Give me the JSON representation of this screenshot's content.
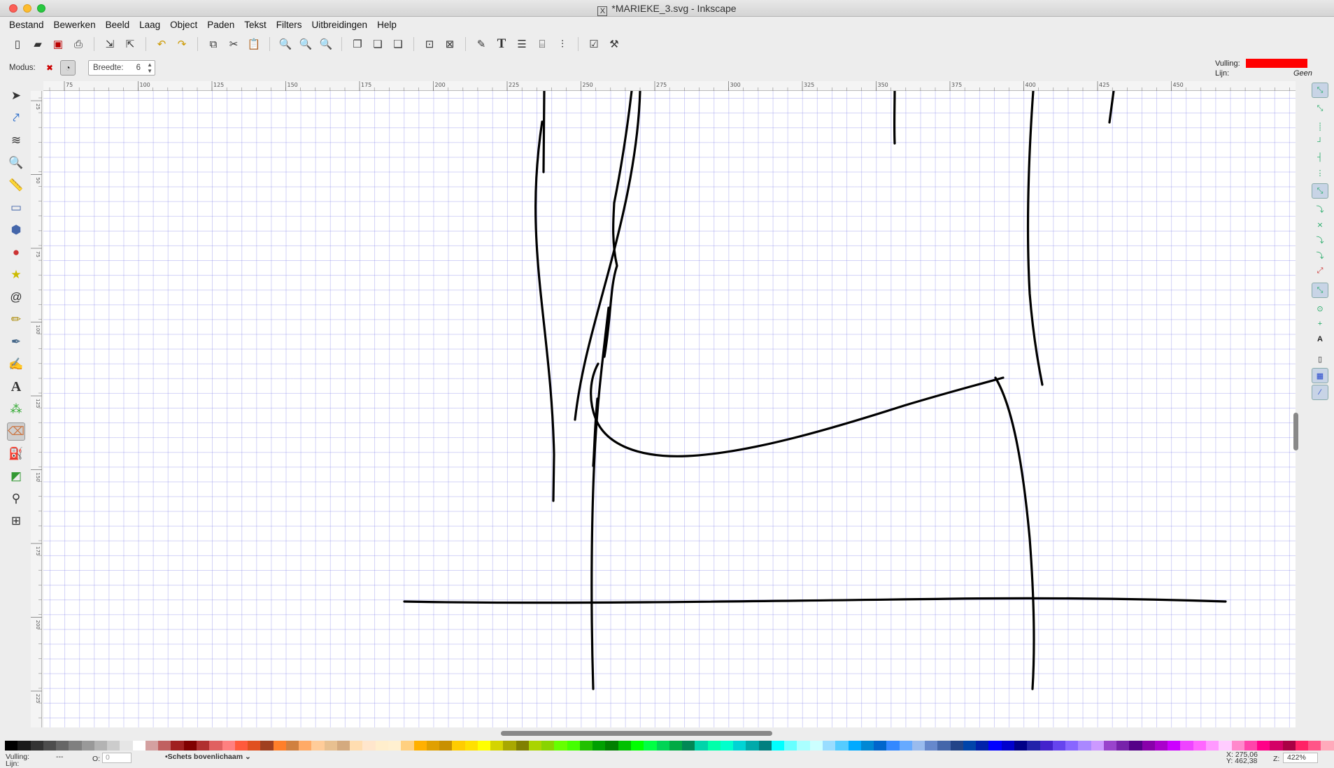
{
  "window": {
    "title": "*MARIEKE_3.svg - Inkscape"
  },
  "menu": [
    "Bestand",
    "Bewerken",
    "Beeld",
    "Laag",
    "Object",
    "Paden",
    "Tekst",
    "Filters",
    "Uitbreidingen",
    "Help"
  ],
  "tool_controls": {
    "mode_label": "Modus:",
    "width_label": "Breedte:",
    "width_value": "6"
  },
  "style_indicator": {
    "fill_label": "Vulling:",
    "fill_color": "#ff0000",
    "stroke_label": "Lijn:",
    "stroke_value": "Geen"
  },
  "ruler_h_labels": [
    "75",
    "100",
    "125",
    "150",
    "175",
    "200",
    "225",
    "250",
    "275",
    "300",
    "325",
    "350",
    "375",
    "400",
    "425",
    "450"
  ],
  "ruler_v_labels": [
    "25",
    "50",
    "75",
    "100",
    "125",
    "150",
    "175",
    "200",
    "225"
  ],
  "statusbar": {
    "fill_label": "Vulling:",
    "fill_value": "---",
    "stroke_label": "Lijn:",
    "opacity_label": "O:",
    "opacity_value": "0",
    "layer": "•Schets bovenlichaam",
    "coords_x": "X: 275,06",
    "coords_y": "Y: 462,38",
    "zoom_label": "Z:",
    "zoom_value": "422%"
  },
  "palette": [
    "#000000",
    "#1a1a1a",
    "#333333",
    "#4d4d4d",
    "#666666",
    "#808080",
    "#999999",
    "#b3b3b3",
    "#cccccc",
    "#e6e6e6",
    "#ffffff",
    "#d4a0a0",
    "#c06060",
    "#a02020",
    "#800000",
    "#b03030",
    "#e06060",
    "#ff8080",
    "#ff5a3c",
    "#e05020",
    "#a04020",
    "#ff7f2a",
    "#d08040",
    "#ffaa66",
    "#ffcc99",
    "#e8c090",
    "#d4aa7f",
    "#ffddb0",
    "#ffe6cc",
    "#ffeecc",
    "#fff0d0",
    "#ffd080",
    "#ffb000",
    "#e0a000",
    "#c89000",
    "#ffcc00",
    "#ffe000",
    "#ffff00",
    "#d4d400",
    "#a8a800",
    "#808000",
    "#aad400",
    "#88d400",
    "#66ff00",
    "#44ff00",
    "#22c000",
    "#00a000",
    "#008000",
    "#00c000",
    "#00ff00",
    "#00ff44",
    "#00d455",
    "#00aa44",
    "#008855",
    "#00d4aa",
    "#00ffaa",
    "#00ffcc",
    "#00d4d4",
    "#00aaaa",
    "#008080",
    "#00ffff",
    "#66ffff",
    "#aaffff",
    "#ccffff",
    "#99ddff",
    "#55ccff",
    "#00aaff",
    "#0088d4",
    "#0066cc",
    "#3388ff",
    "#66aaff",
    "#99bbee",
    "#6688cc",
    "#4466aa",
    "#224488",
    "#0044aa",
    "#0022aa",
    "#0000ff",
    "#0000cc",
    "#000088",
    "#2222aa",
    "#4422cc",
    "#6644ee",
    "#8866ff",
    "#aa88ff",
    "#cc99ff",
    "#9944cc",
    "#7722aa",
    "#550088",
    "#8800aa",
    "#aa00cc",
    "#cc00ff",
    "#ee44ff",
    "#ff66ff",
    "#ff99ff",
    "#ffccff",
    "#ff88cc",
    "#ff44aa",
    "#ff0088",
    "#d40066",
    "#aa0044",
    "#ff2266",
    "#ff5588",
    "#ffaabb"
  ]
}
